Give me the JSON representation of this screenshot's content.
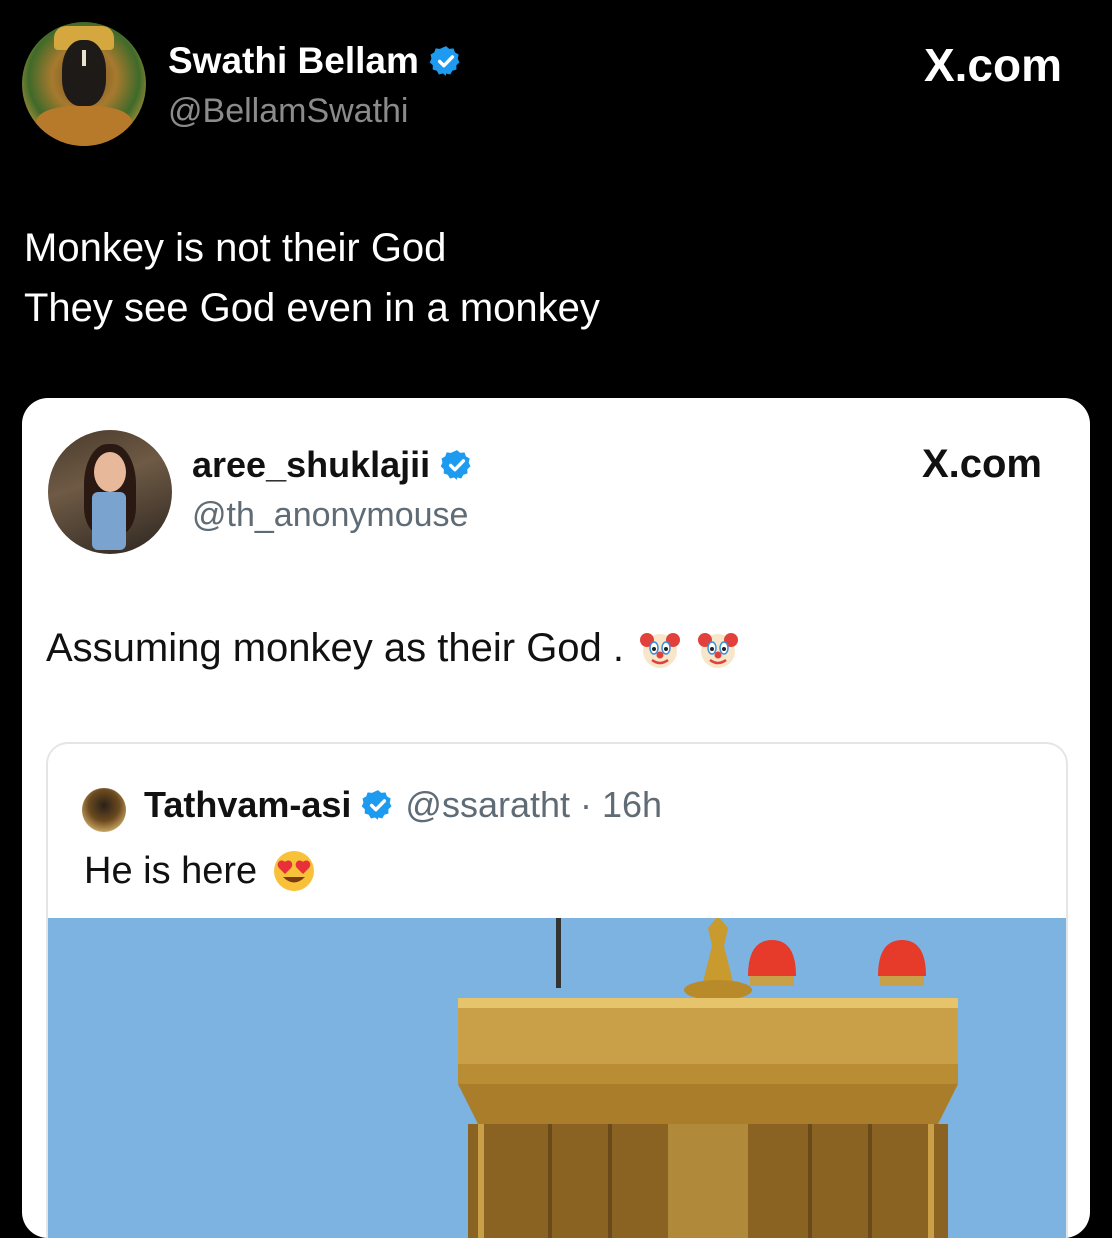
{
  "outer_tweet": {
    "display_name": "Swathi Bellam",
    "handle": "@BellamSwathi",
    "source": "X.com",
    "text_lines": [
      "Monkey is not their God",
      "They see God even in a monkey"
    ]
  },
  "quoted_card": {
    "display_name": "aree_shuklajii",
    "handle": "@th_anonymouse",
    "source": "X.com",
    "text": "Assuming monkey as their God .",
    "emoji": "clown-face x2"
  },
  "nested_quote": {
    "display_name": "Tathvam-asi",
    "handle": "@ssaratht",
    "time": "· 16h",
    "text": "He is here",
    "emoji": "heart-eyes"
  },
  "colors": {
    "background": "#000000",
    "verified": "#1d9bf0",
    "card": "#ffffff",
    "sky": "#7db3e1",
    "gold": "#d4a73f"
  }
}
